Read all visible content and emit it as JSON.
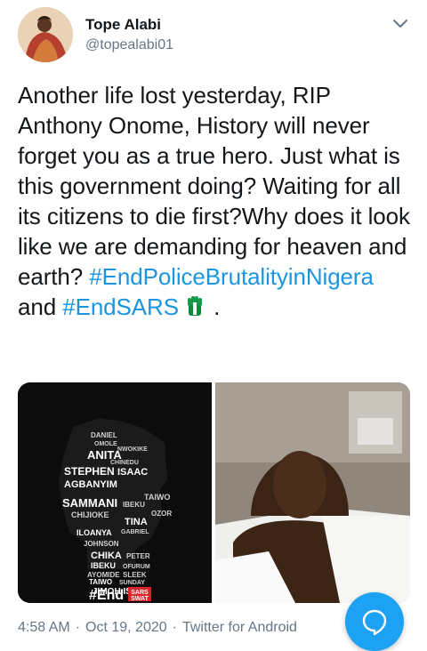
{
  "tweet": {
    "author_name": "Tope Alabi",
    "handle": "@topealabi01",
    "text_main": "Another life lost yesterday, RIP Anthony Onome, History will never forget you as a true hero. Just what is this government doing? Waiting for all its citizens to die first?Why does it look like we are demanding for heaven and earth?",
    "hashtag_1": "#EndPoliceBrutalityinNigera",
    "conjunction": "and",
    "hashtag_2": "#EndSARS",
    "trailing": "."
  },
  "media": {
    "poster": {
      "names": [
        "DANIEL",
        "OMOLE",
        "ANITA",
        "NWOKIKE",
        "STEPHEN",
        "ISAAC",
        "CHINEDU",
        "AGBANYIM",
        "SAMMANI",
        "IBEKU",
        "CHIJIOKE",
        "TINA",
        "TAIWO",
        "OZOR",
        "ILOANYA",
        "GABRIEL",
        "JOHNSON",
        "CHIKA",
        "PETER",
        "IBEKU",
        "OFURUM",
        "AYOMIDE",
        "SLEEK",
        "TAIWO",
        "SUNDAY"
      ],
      "footer_names": "JIMOH ISIAQ",
      "end_label": "#End",
      "badge_top": "SARS",
      "badge_bottom": "SWAT"
    }
  },
  "footer": {
    "time": "4:58 AM",
    "date": "Oct 19, 2020",
    "client": "Twitter for Android"
  },
  "icons": {
    "caret": "chevron-down-icon",
    "fab": "compose-reply-icon",
    "emoji": "raised-fist-emoji"
  },
  "colors": {
    "link": "#1b95e0",
    "accent": "#1da1f2",
    "muted": "#657786",
    "fist_green": "#0b8a3c"
  }
}
